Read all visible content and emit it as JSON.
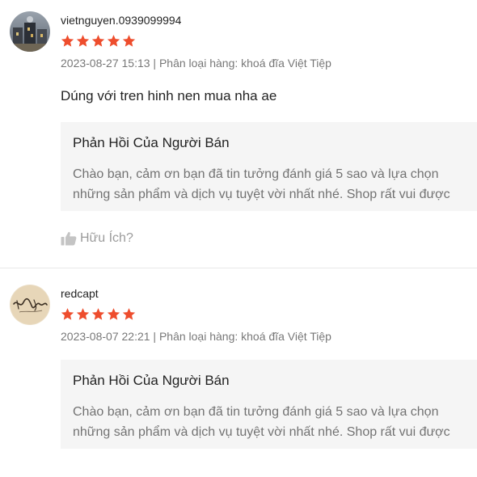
{
  "colors": {
    "star": "#ee4d2d",
    "reply_bg": "#f5f5f5",
    "muted_text": "#8a8a8a"
  },
  "reviews": [
    {
      "username": "vietnguyen.0939099994",
      "rating": 5,
      "meta": "2023-08-27 15:13 | Phân loại hàng: khoá đĩa Việt Tiệp",
      "comment": "Dúng với tren hinh nen mua nha ae",
      "avatar_icon": "user-avatar-photo",
      "reply": {
        "title": "Phản Hồi Của Người Bán",
        "lines": [
          "Chào bạn, cảm ơn bạn đã tin tưởng đánh giá 5 sao và lựa chọn",
          "những sản phẩm và dịch vụ tuyệt vời nhất nhé. Shop rất vui được"
        ]
      },
      "helpful_label": "Hữu Ích?",
      "helpful_icon": "thumbs-up-icon"
    },
    {
      "username": "redcapt",
      "rating": 5,
      "meta": "2023-08-07 22:21 | Phân loại hàng: khoá đĩa Việt Tiệp",
      "avatar_icon": "user-avatar-signature",
      "reply": {
        "title": "Phản Hồi Của Người Bán",
        "lines": [
          "Chào bạn, cảm ơn bạn đã tin tưởng đánh giá 5 sao và lựa chọn",
          "những sản phẩm và dịch vụ tuyệt vời nhất nhé. Shop rất vui được"
        ]
      }
    }
  ]
}
